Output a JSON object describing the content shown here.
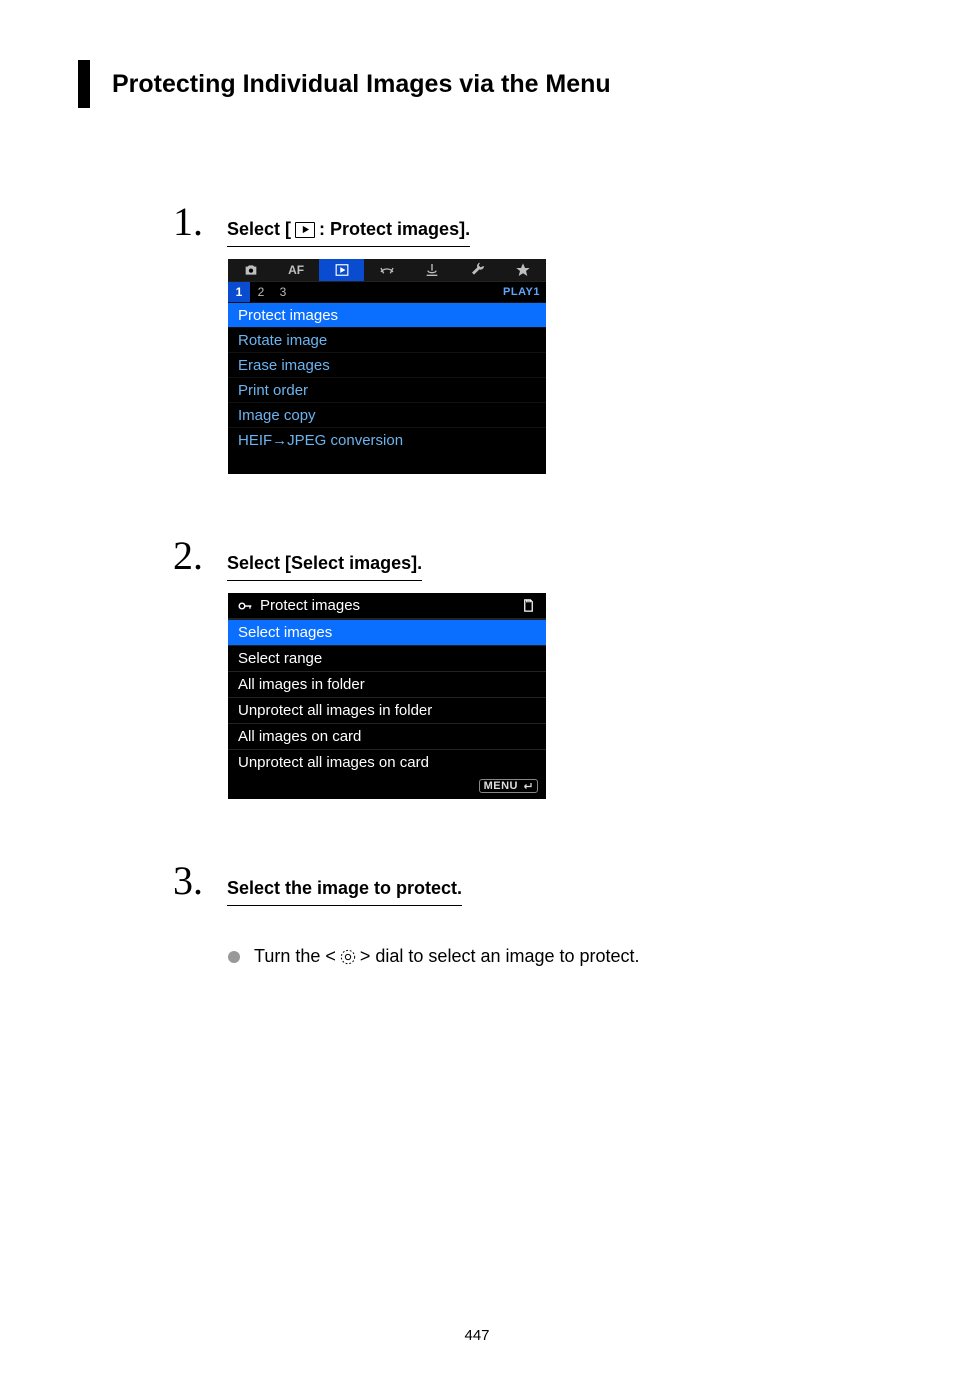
{
  "heading": "Protecting Individual Images via the Menu",
  "steps": [
    {
      "num": "1.",
      "title_prefix": "Select [",
      "title_suffix": ": Protect images].",
      "screen": {
        "tabs": [
          "camera",
          "AF",
          "play",
          "wireless",
          "net",
          "wrench",
          "star"
        ],
        "active_tab_index": 2,
        "subtabs": [
          "1",
          "2",
          "3"
        ],
        "active_subtab_index": 0,
        "subtab_label": "PLAY1",
        "items": [
          "Protect images",
          "Rotate image",
          "Erase images",
          "Print order",
          "Image copy",
          "HEIF→JPEG conversion"
        ],
        "selected_index": 0
      }
    },
    {
      "num": "2.",
      "title_plain": "Select [Select images].",
      "screen2": {
        "header_title": "Protect images",
        "items": [
          "Select images",
          "Select range",
          "All images in folder",
          "Unprotect all images in folder",
          "All images on card",
          "Unprotect all images on card"
        ],
        "selected_index": 0,
        "footer_label": "MENU"
      }
    },
    {
      "num": "3.",
      "title_plain": "Select the image to protect.",
      "bullet_prefix": "Turn the < ",
      "bullet_suffix": " > dial to select an image to protect."
    }
  ],
  "page_number": "447"
}
